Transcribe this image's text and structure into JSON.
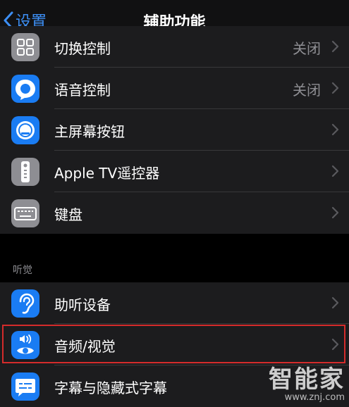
{
  "nav": {
    "back_label": "设置",
    "title": "辅助功能"
  },
  "rows_top": [
    {
      "label": "切换控制",
      "value": "关闭",
      "icon": "switch-control-icon"
    },
    {
      "label": "语音控制",
      "value": "关闭",
      "icon": "voice-control-icon"
    },
    {
      "label": "主屏幕按钮",
      "value": "",
      "icon": "home-button-icon"
    },
    {
      "label": "Apple TV遥控器",
      "value": "",
      "icon": "apple-tv-remote-icon"
    },
    {
      "label": "键盘",
      "value": "",
      "icon": "keyboard-icon"
    }
  ],
  "hearing_section": {
    "header": "听觉",
    "rows": [
      {
        "label": "助听设备",
        "icon": "ear-icon"
      },
      {
        "label": "音频/视觉",
        "icon": "audio-visual-icon"
      },
      {
        "label": "字幕与隐藏式字幕",
        "icon": "subtitles-icon"
      }
    ]
  },
  "watermark": {
    "text": "智能家",
    "url": "www.znj.com"
  },
  "colors": {
    "accent_blue": "#3d8ff5",
    "icon_blue": "#1a7cf3",
    "icon_gray": "#8e8e93",
    "highlight_red": "#d42b2b"
  }
}
